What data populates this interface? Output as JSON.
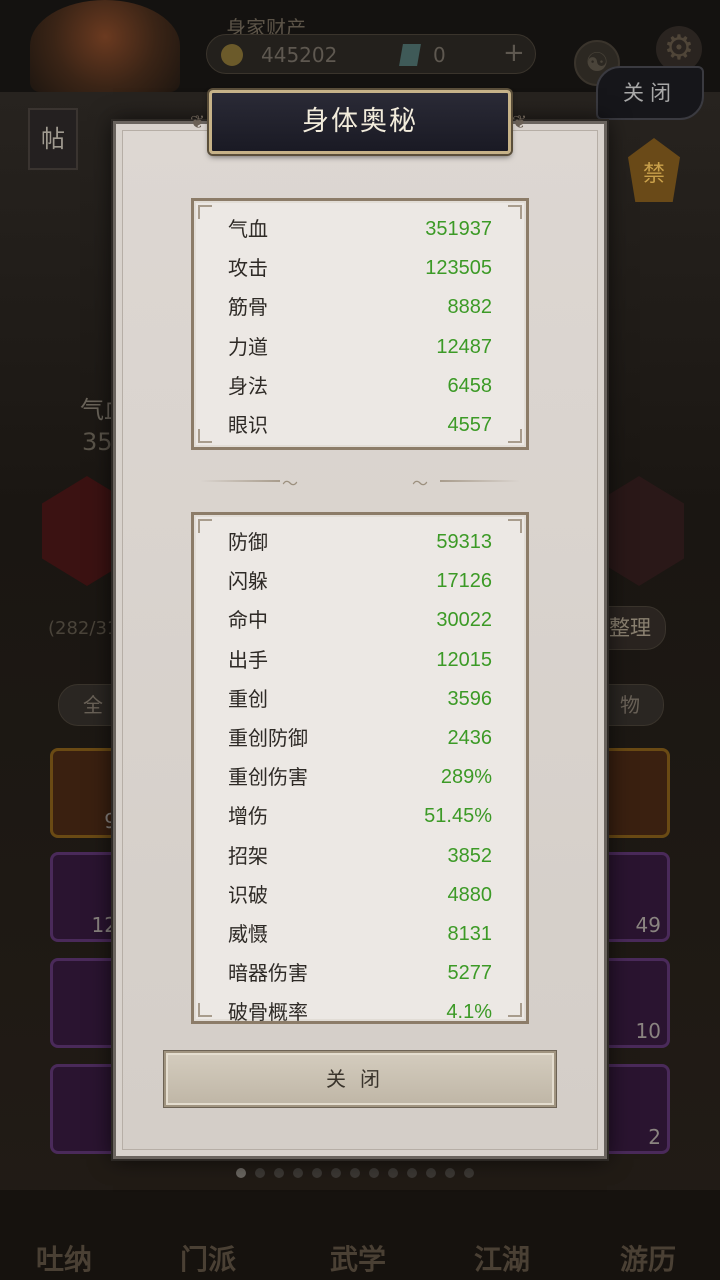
{
  "background": {
    "wealth_label": "身家财产",
    "coins": "445202",
    "gems": "0",
    "plus": "+",
    "close_label": "关闭",
    "tie_label": "帖",
    "ban_label": "禁",
    "stat_fragment_label": "气血",
    "stat_fragment_value": "35",
    "inventory_count": "(282/31",
    "sort_label": "整理",
    "filter_all": "全",
    "filter_item": "物",
    "slot_counts": [
      "9",
      "12",
      "49",
      "10",
      "2"
    ],
    "nav": [
      "吐纳",
      "门派",
      "武学",
      "江湖",
      "游历"
    ],
    "page_dots": 13,
    "active_dot": 0
  },
  "dialog": {
    "title": "身体奥秘",
    "close_button": "关闭"
  },
  "primary_stats": [
    {
      "name": "气血",
      "value": "351937"
    },
    {
      "name": "攻击",
      "value": "123505"
    },
    {
      "name": "筋骨",
      "value": "8882"
    },
    {
      "name": "力道",
      "value": "12487"
    },
    {
      "name": "身法",
      "value": "6458"
    },
    {
      "name": "眼识",
      "value": "4557"
    }
  ],
  "secondary_stats": [
    {
      "name": "防御",
      "value": "59313"
    },
    {
      "name": "闪躲",
      "value": "17126"
    },
    {
      "name": "命中",
      "value": "30022"
    },
    {
      "name": "出手",
      "value": "12015"
    },
    {
      "name": "重创",
      "value": "3596"
    },
    {
      "name": "重创防御",
      "value": "2436"
    },
    {
      "name": "重创伤害",
      "value": "289%"
    },
    {
      "name": "增伤",
      "value": "51.45%"
    },
    {
      "name": "招架",
      "value": "3852"
    },
    {
      "name": "识破",
      "value": "4880"
    },
    {
      "name": "威慑",
      "value": "8131"
    },
    {
      "name": "暗器伤害",
      "value": "5277"
    },
    {
      "name": "破骨概率",
      "value": "4.1%"
    }
  ],
  "colors": {
    "stat_value": "#3c9a26",
    "stat_name": "#2e2a26",
    "title_plate": "#1a1a24"
  }
}
